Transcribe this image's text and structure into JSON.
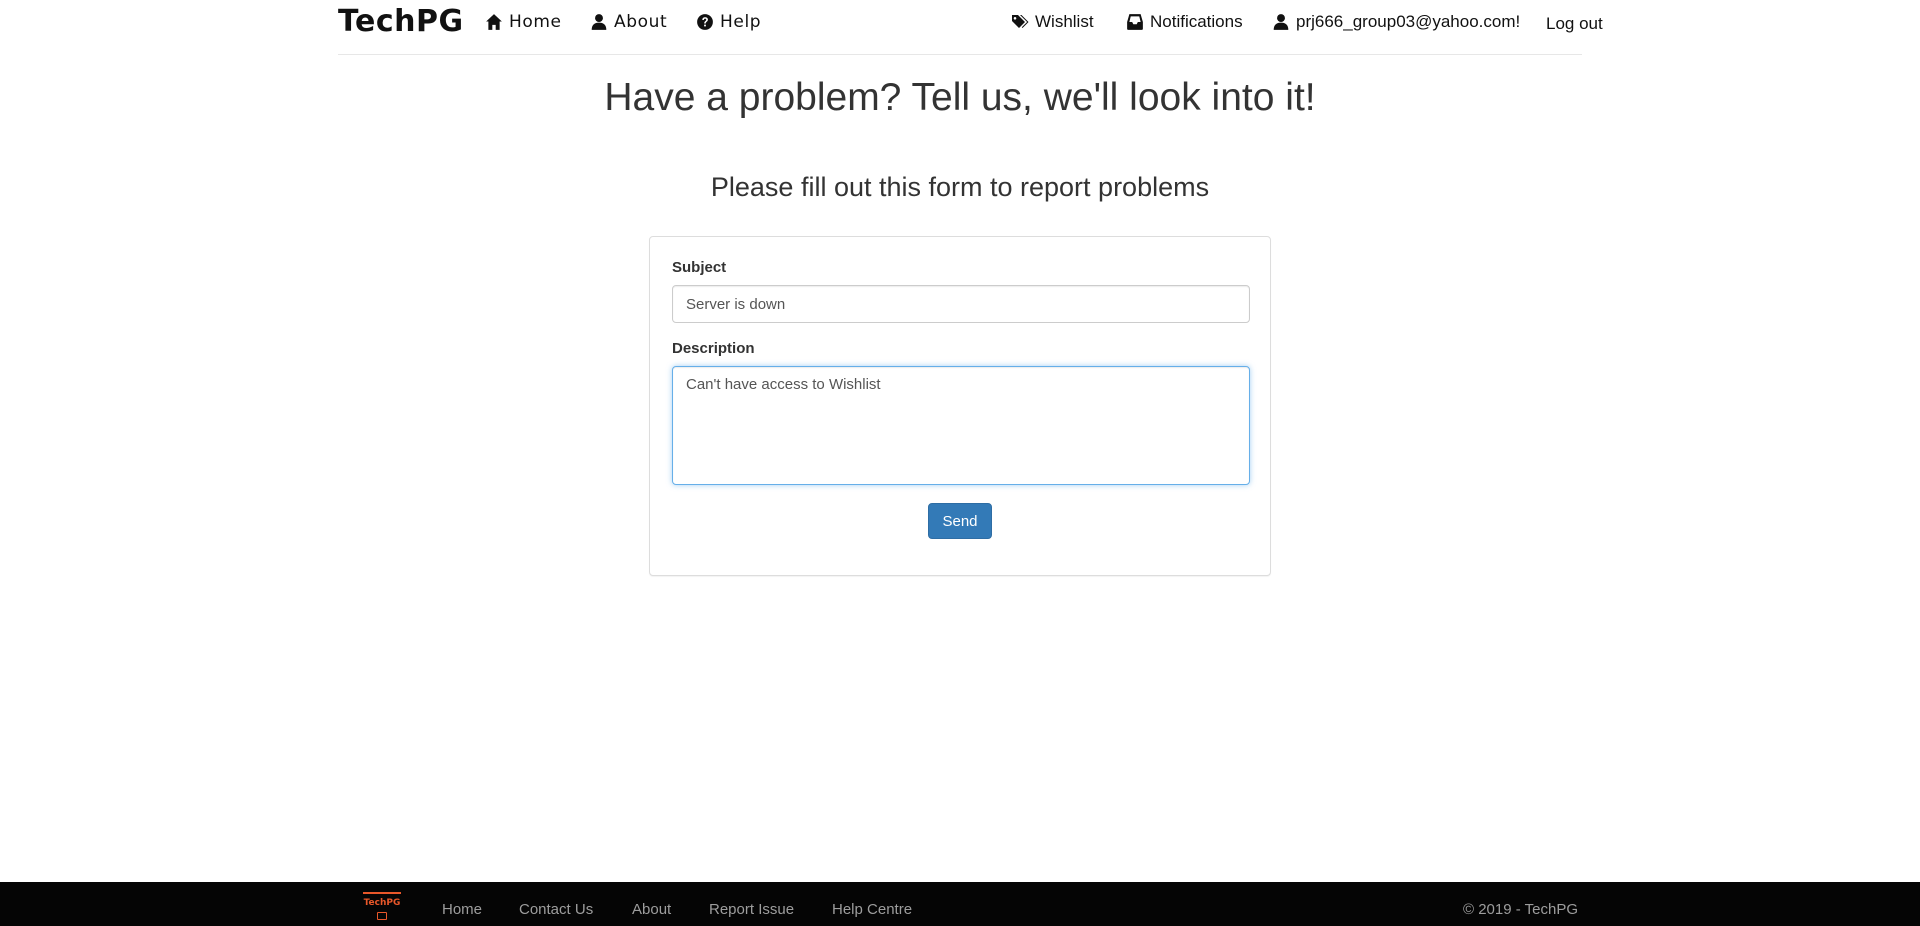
{
  "navbar": {
    "brand": "TechPG",
    "left_links": [
      {
        "label": "Home",
        "icon": "home-icon"
      },
      {
        "label": "About",
        "icon": "user-icon"
      },
      {
        "label": "Help",
        "icon": "question-circle-icon"
      }
    ],
    "right_links": [
      {
        "label": "Wishlist",
        "icon": "tags-icon"
      },
      {
        "label": "Notifications",
        "icon": "inbox-icon"
      },
      {
        "label": "prj666_group03@yahoo.com!",
        "icon": "user-icon"
      },
      {
        "label": "Log out"
      }
    ]
  },
  "page": {
    "title": "Have a problem? Tell us, we'll look into it!",
    "subtitle": "Please fill out this form to report problems"
  },
  "form": {
    "subject_label": "Subject",
    "subject_value": "Server is down",
    "description_label": "Description",
    "description_value": "Can't have access to Wishlist",
    "send_label": "Send",
    "accent_color": "#337ab7"
  },
  "footer": {
    "logo_text": "TechPG",
    "links": [
      "Home",
      "Contact Us",
      "About",
      "Report Issue",
      "Help Centre"
    ],
    "copyright": "© 2019 - TechPG",
    "logo_color": "#e8572a"
  }
}
